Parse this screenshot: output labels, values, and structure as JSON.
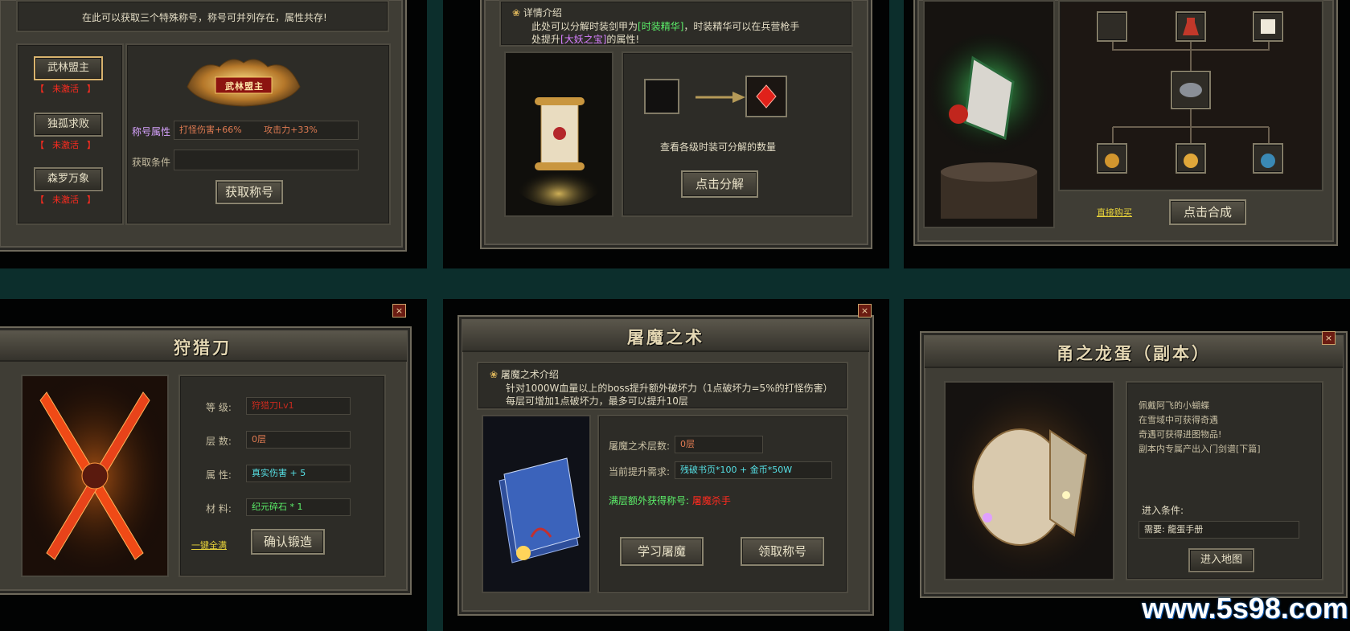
{
  "panel_title": {
    "intro": "在此可以获取三个特殊称号，称号可并列存在，属性共存!",
    "tabs": [
      {
        "name": "武林盟主",
        "status": "未激活"
      },
      {
        "name": "独孤求败",
        "status": "未激活"
      },
      {
        "name": "森罗万象",
        "status": "未激活"
      }
    ],
    "badge_text": "武林盟主",
    "attr_label": "称号属性",
    "attr_values": [
      "打怪伤害+66%",
      "攻击力+33%"
    ],
    "cond_label": "获取条件",
    "get_button": "获取称号",
    "bracket_left": "【",
    "bracket_right": "】"
  },
  "panel_decompose": {
    "intro_title": "详情介绍",
    "line1_a": "此处可以分解时装剑甲为",
    "line1_highlight": "[时装精华]",
    "line1_b": "，时装精华可以在兵营枪手",
    "line2_a": "处提升",
    "line2_highlight": "[大妖之宝]",
    "line2_b": "的属性!",
    "hint": "查看各级时装可分解的数量",
    "button": "点击分解"
  },
  "panel_synth": {
    "buy_link": "直接购买",
    "button": "点击合成"
  },
  "panel_blade": {
    "title": "狩猎刀",
    "fields": [
      {
        "label": "等 级:",
        "value": "狩猎刀Lv1"
      },
      {
        "label": "层 数:",
        "value": "0层"
      },
      {
        "label": "属 性:",
        "value": "真实伤害 + 5"
      },
      {
        "label": "材 料:",
        "value": "纪元碎石 * 1"
      }
    ],
    "link": "一键全满",
    "button": "确认锻造"
  },
  "panel_demon": {
    "title": "屠魔之术",
    "intro_title": "屠魔之术介绍",
    "intro_line1": "针对1000W血量以上的boss提升额外破坏力（1点破坏力=5%的打怪伤害）",
    "intro_line2": "每层可增加1点破坏力，最多可以提升10层",
    "layers_label": "屠魔之术层数:",
    "layers_value": "0层",
    "req_label": "当前提升需求:",
    "req_value": "残破书页*100 + 金币*50W",
    "reward_label": "满层额外获得称号:",
    "reward_value": "屠魔杀手",
    "learn_button": "学习屠魔",
    "claim_button": "领取称号"
  },
  "panel_dragon": {
    "title": "甬之龙蛋（副本）",
    "desc": [
      "佩戴阿飞的小蝴蝶",
      "在雪域中可获得奇遇",
      "奇遇可获得进图物品!",
      "副本内专属产出入门剑谱[下篇]"
    ],
    "cond_label": "进入条件:",
    "cond_value": "需要: 龍蛋手册",
    "button": "进入地图"
  },
  "close_glyph": "×",
  "watermark": "www.5s98.com",
  "colors": {
    "background": "#0c2e2c",
    "panel": "#3f3d35",
    "gold": "#e4d7b3",
    "red": "#ff2b1f",
    "green": "#5cf06a",
    "cyan": "#56e1e6",
    "orange": "#e07b52",
    "purple": "#d77fff",
    "yellow_link": "#e8d33a"
  }
}
